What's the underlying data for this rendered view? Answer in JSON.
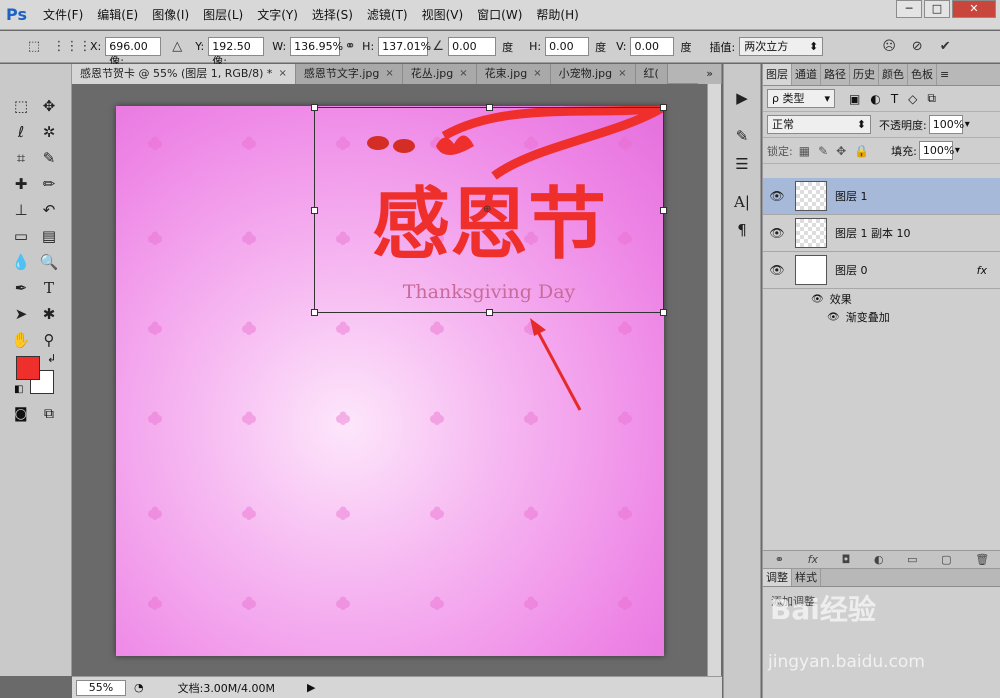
{
  "app": {
    "logo": "Ps"
  },
  "menu": [
    "文件(F)",
    "编辑(E)",
    "图像(I)",
    "图层(L)",
    "文字(Y)",
    "选择(S)",
    "滤镜(T)",
    "视图(V)",
    "窗口(W)",
    "帮助(H)"
  ],
  "window_buttons": {
    "minimize": "─",
    "maximize": "□",
    "close": "✕"
  },
  "options": {
    "x_label": "X:",
    "x_value": "696.00 像:",
    "y_label": "Y:",
    "y_value": "192.50 像:",
    "w_label": "W:",
    "w_value": "136.95%",
    "h_label": "H:",
    "h_value": "137.01%",
    "angle_value": "0.00",
    "angle_unit": "度",
    "hskew_label": "H:",
    "hskew_value": "0.00",
    "hskew_unit": "度",
    "vskew_label": "V:",
    "vskew_value": "0.00",
    "vskew_unit": "度",
    "interp_label": "插值:",
    "interp_value": "两次立方"
  },
  "tabs": [
    {
      "label": "感恩节贺卡 @ 55% (图层 1, RGB/8) *",
      "active": true
    },
    {
      "label": "感恩节文字.jpg",
      "active": false
    },
    {
      "label": "花丛.jpg",
      "active": false
    },
    {
      "label": "花束.jpg",
      "active": false
    },
    {
      "label": "小宠物.jpg",
      "active": false
    },
    {
      "label": "红(",
      "active": false
    }
  ],
  "canvas": {
    "title_art": "感恩节",
    "subtitle_art": "Thanksgiving Day",
    "colors": {
      "title": "#ee2f2c",
      "subtitle": "#c96a9a",
      "pink": "#ee86e6"
    }
  },
  "status": {
    "zoom": "55%",
    "doc": "文档:3.00M/4.00M"
  },
  "layers_panel": {
    "tabs": [
      "图层",
      "通道",
      "路径",
      "历史",
      "颜色",
      "色板"
    ],
    "filter": "ρ 类型",
    "blend_mode": "正常",
    "opacity_label": "不透明度:",
    "opacity_value": "100%",
    "lock_label": "锁定:",
    "fill_label": "填充:",
    "fill_value": "100%",
    "layers": [
      {
        "name": "图层 1",
        "selected": true
      },
      {
        "name": "图层 1 副本 10",
        "selected": false
      },
      {
        "name": "图层 0",
        "selected": false,
        "fx": "fx"
      }
    ],
    "effects_label": "效果",
    "effect_item": "渐变叠加"
  },
  "adjust_panel": {
    "tabs": [
      "调整",
      "样式"
    ],
    "add_label": "添加调整"
  },
  "watermark": {
    "text": "Bai经验",
    "url": "jingyan.baidu.com"
  }
}
